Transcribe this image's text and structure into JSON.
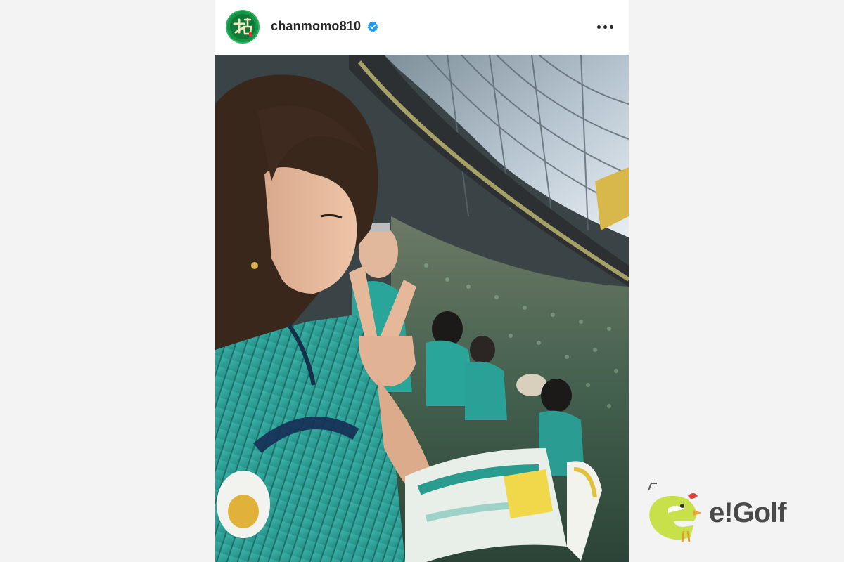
{
  "post": {
    "username": "chanmomo810",
    "verified_icon": "verified-badge-icon",
    "more_icon": "more-options-icon",
    "avatar_icon": "profile-avatar"
  },
  "colors": {
    "page_background": "#f3f3f3",
    "verified_blue": "#1d9bf0",
    "jersey_teal": "#2aa59a",
    "brand_green": "#c8e04a"
  },
  "brand": {
    "name": "e!Golf",
    "logo_icon": "egolf-chick-logo"
  }
}
